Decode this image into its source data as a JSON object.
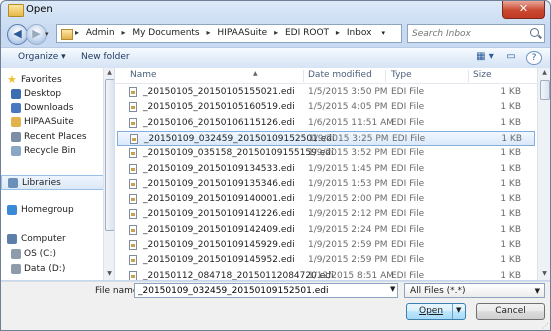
{
  "window": {
    "title": "Open",
    "close_label": "✕"
  },
  "nav": {
    "back_label": "◀",
    "forward_label": "▶",
    "history_label": "▾",
    "breadcrumbs": [
      "Admin",
      "My Documents",
      "HIPAASuite",
      "EDI ROOT",
      "Inbox"
    ],
    "breadcrumb_sep": "▸",
    "refresh_label": "↻",
    "search_placeholder": "Search Inbox"
  },
  "toolbar": {
    "organize_label": "Organize ▾",
    "new_folder_label": "New folder",
    "views_label": "▦ ▾",
    "pane_label": "▭",
    "help_label": "?"
  },
  "sidebar": {
    "items": [
      {
        "label": "Favorites",
        "icon": "star-icon",
        "color": "#f0c030",
        "head": true
      },
      {
        "label": "Desktop",
        "icon": "desktop-icon",
        "color": "#3b6db3"
      },
      {
        "label": "Downloads",
        "icon": "downloads-icon",
        "color": "#4a78c0"
      },
      {
        "label": "HIPAASuite",
        "icon": "folder-icon",
        "color": "#e3b24a"
      },
      {
        "label": "Recent Places",
        "icon": "recent-places-icon",
        "color": "#7b8ea6"
      },
      {
        "label": "Recycle Bin",
        "icon": "recycle-bin-icon",
        "color": "#8aa7c6"
      },
      {
        "label": "Libraries",
        "icon": "libraries-icon",
        "color": "#6a8fb9",
        "head": true,
        "selected": true
      },
      {
        "label": "Homegroup",
        "icon": "homegroup-icon",
        "color": "#3b8ad8",
        "head": true
      },
      {
        "label": "Computer",
        "icon": "computer-icon",
        "color": "#5b7fa8",
        "head": true
      },
      {
        "label": "OS (C:)",
        "icon": "drive-c-icon",
        "color": "#8e9bab"
      },
      {
        "label": "Data (D:)",
        "icon": "drive-d-icon",
        "color": "#8e9bab"
      }
    ]
  },
  "filelist": {
    "columns": {
      "name": "Name",
      "date": "Date modified",
      "type": "Type",
      "size": "Size"
    },
    "rows": [
      {
        "name": "_20150105_20150105155021.edi",
        "date": "1/5/2015 3:50 PM",
        "type": "EDI File",
        "size": "1 KB"
      },
      {
        "name": "_20150105_20150105160519.edi",
        "date": "1/5/2015 4:05 PM",
        "type": "EDI File",
        "size": "1 KB"
      },
      {
        "name": "_20150106_20150106115126.edi",
        "date": "1/6/2015 11:51 AM",
        "type": "EDI File",
        "size": "1 KB"
      },
      {
        "name": "_20150109_032459_20150109152501.edi",
        "date": "1/9/2015 3:25 PM",
        "type": "EDI File",
        "size": "1 KB",
        "selected": true
      },
      {
        "name": "_20150109_035158_20150109155159.edi",
        "date": "1/9/2015 3:52 PM",
        "type": "EDI File",
        "size": "1 KB"
      },
      {
        "name": "_20150109_20150109134533.edi",
        "date": "1/9/2015 1:45 PM",
        "type": "EDI File",
        "size": "1 KB"
      },
      {
        "name": "_20150109_20150109135346.edi",
        "date": "1/9/2015 1:53 PM",
        "type": "EDI File",
        "size": "1 KB"
      },
      {
        "name": "_20150109_20150109140001.edi",
        "date": "1/9/2015 2:00 PM",
        "type": "EDI File",
        "size": "1 KB"
      },
      {
        "name": "_20150109_20150109141226.edi",
        "date": "1/9/2015 2:12 PM",
        "type": "EDI File",
        "size": "1 KB"
      },
      {
        "name": "_20150109_20150109142409.edi",
        "date": "1/9/2015 2:24 PM",
        "type": "EDI File",
        "size": "1 KB"
      },
      {
        "name": "_20150109_20150109145929.edi",
        "date": "1/9/2015 2:59 PM",
        "type": "EDI File",
        "size": "1 KB"
      },
      {
        "name": "_20150109_20150109145952.edi",
        "date": "1/9/2015 2:59 PM",
        "type": "EDI File",
        "size": "1 KB"
      },
      {
        "name": "_20150112_084718_20150112084720.edi",
        "date": "1/12/2015 8:51 AM",
        "type": "EDI File",
        "size": "1 KB"
      }
    ]
  },
  "footer": {
    "file_name_label": "File name:",
    "file_name_value": "_20150109_032459_20150109152501.edi",
    "file_type_value": "All Files (*.*)",
    "open_label": "Open",
    "cancel_label": "Cancel"
  }
}
